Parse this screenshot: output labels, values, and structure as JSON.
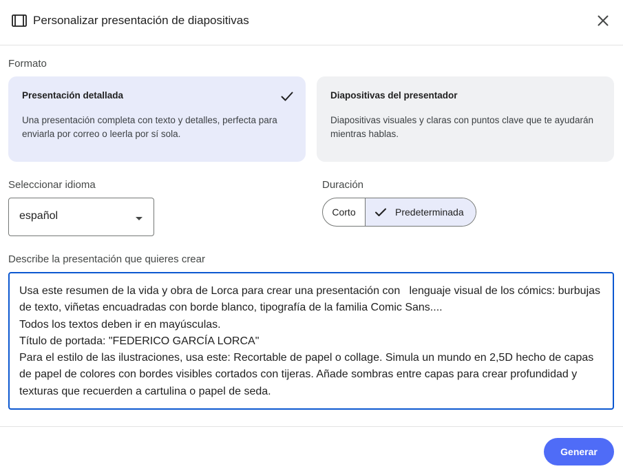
{
  "dialog": {
    "title": "Personalizar presentación de diapositivas",
    "slides_icon": "slideshow-icon",
    "close_icon": "close-icon"
  },
  "format": {
    "label": "Formato",
    "options": [
      {
        "title": "Presentación detallada",
        "description": "Una presentación completa con texto y detalles, perfecta para enviarla por correo o leerla por sí sola.",
        "selected": true
      },
      {
        "title": "Diapositivas del presentador",
        "description": "Diapositivas visuales y claras con puntos clave que te ayudarán mientras hablas.",
        "selected": false
      }
    ]
  },
  "language": {
    "label": "Seleccionar idioma",
    "value": "español"
  },
  "duration": {
    "label": "Duración",
    "options": [
      "Corto",
      "Predeterminada"
    ],
    "selected": "Predeterminada"
  },
  "description": {
    "label": "Describe la presentación que quieres crear",
    "value": "Usa este resumen de la vida y obra de Lorca para crear una presentación con   lenguaje visual de los cómics: burbujas de texto, viñetas encuadradas con borde blanco, tipografía de la familia Comic Sans....\nTodos los textos deben ir en mayúsculas.\nTítulo de portada: \"FEDERICO GARCÍA LORCA\"\nPara el estilo de las ilustraciones, usa este: Recortable de papel o collage. Simula un mundo en 2,5D hecho de capas de papel de colores con bordes visibles cortados con tijeras. Añade sombras entre capas para crear profundidad y texturas que recuerden a cartulina o papel de seda."
  },
  "actions": {
    "generate_label": "Generar"
  },
  "colors": {
    "accent": "#0b57d0",
    "selected_bg": "#e8ebfa",
    "button_bg": "#4f6cf7"
  }
}
